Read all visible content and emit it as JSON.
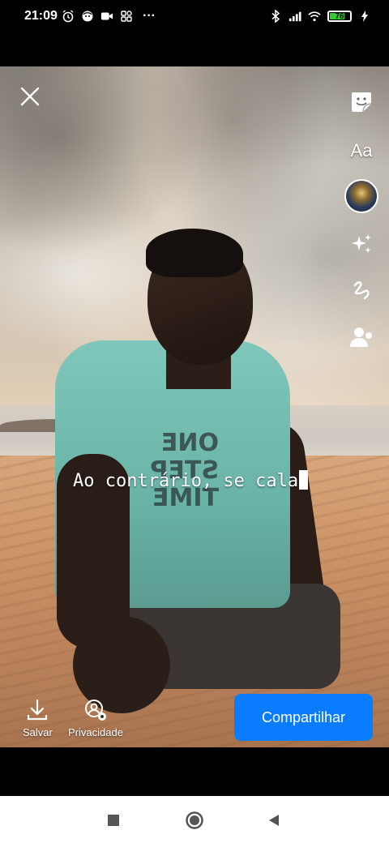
{
  "status_bar": {
    "time": "21:09",
    "more": "···",
    "battery_level": "76",
    "battery_fraction": 0.76,
    "icons_left": [
      "alarm-icon",
      "face-icon",
      "video-icon",
      "app-icon"
    ],
    "icons_right": [
      "bluetooth-icon",
      "signal-icon",
      "wifi-icon",
      "battery-icon",
      "charging-icon"
    ]
  },
  "editor": {
    "caption_text": "Ao contrário, se cala",
    "tools": [
      "sticker-icon",
      "text-tool",
      "avatar-sticker",
      "effects-sparkle-icon",
      "draw-icon",
      "tag-person-icon"
    ],
    "text_tool_label": "Aa"
  },
  "shirt_print": {
    "line1": "ONE",
    "line2": "STEP",
    "line3": "TIME"
  },
  "bottom_bar": {
    "save_label": "Salvar",
    "privacy_label": "Privacidade",
    "share_label": "Compartilhar"
  },
  "colors": {
    "accent": "#0a7cff",
    "battery": "#33cc33"
  }
}
